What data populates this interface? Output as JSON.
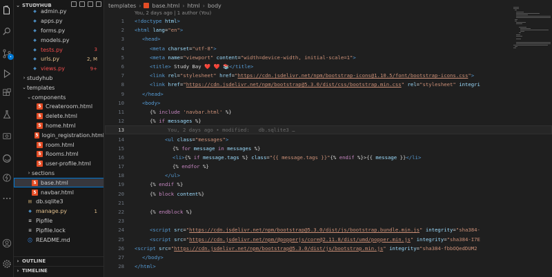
{
  "explorer": {
    "root": "STUDYHUB",
    "items": [
      {
        "name": "admin.py",
        "type": "py",
        "depth": 2
      },
      {
        "name": "apps.py",
        "type": "py",
        "depth": 2
      },
      {
        "name": "forms.py",
        "type": "py",
        "depth": 2
      },
      {
        "name": "models.py",
        "type": "py",
        "depth": 2
      },
      {
        "name": "tests.py",
        "type": "py",
        "depth": 2,
        "badge": "3",
        "status": "error"
      },
      {
        "name": "urls.py",
        "type": "py",
        "depth": 2,
        "badge": "2, M",
        "status": "modified"
      },
      {
        "name": "views.py",
        "type": "py",
        "depth": 2,
        "badge": "9+",
        "status": "error"
      },
      {
        "name": "studyhub",
        "type": "folder",
        "depth": 1,
        "expanded": false
      },
      {
        "name": "templates",
        "type": "folder",
        "depth": 1,
        "expanded": true
      },
      {
        "name": "components",
        "type": "folder",
        "depth": 2,
        "expanded": true
      },
      {
        "name": "Createroom.html",
        "type": "html",
        "depth": 3
      },
      {
        "name": "delete.html",
        "type": "html",
        "depth": 3
      },
      {
        "name": "home.html",
        "type": "html",
        "depth": 3
      },
      {
        "name": "login_registration.html",
        "type": "html",
        "depth": 3
      },
      {
        "name": "room.html",
        "type": "html",
        "depth": 3
      },
      {
        "name": "Rooms.html",
        "type": "html",
        "depth": 3
      },
      {
        "name": "user-profile.html",
        "type": "html",
        "depth": 3
      },
      {
        "name": "sections",
        "type": "folder",
        "depth": 2,
        "expanded": false
      },
      {
        "name": "base.html",
        "type": "html",
        "depth": 2,
        "selected": true
      },
      {
        "name": "navbar.html",
        "type": "html",
        "depth": 2
      },
      {
        "name": "db.sqlite3",
        "type": "db",
        "depth": 1
      },
      {
        "name": "manage.py",
        "type": "py",
        "depth": 1,
        "badge": "1",
        "status": "modified"
      },
      {
        "name": "Pipfile",
        "type": "txt",
        "depth": 1
      },
      {
        "name": "Pipfile.lock",
        "type": "txt",
        "depth": 1
      },
      {
        "name": "README.md",
        "type": "info",
        "depth": 1
      }
    ],
    "outline_label": "OUTLINE",
    "timeline_label": "TIMELINE"
  },
  "breadcrumb": [
    "templates",
    "base.html",
    "html",
    "body"
  ],
  "blame_header": "You, 2 days ago | 1 author (You)",
  "inline_blame": "You, 2 days ago • modified:   db.sqlite3 …",
  "active_line": 13,
  "code_lines": [
    {
      "n": "1",
      "indent": 0,
      "parts": [
        [
          "tag",
          "<!doctype "
        ],
        [
          "attr",
          "html"
        ],
        [
          "tag",
          ">"
        ]
      ]
    },
    {
      "n": "2",
      "indent": 0,
      "parts": [
        [
          "tag",
          "<html "
        ],
        [
          "attr",
          "lang"
        ],
        [
          "txt",
          "="
        ],
        [
          "str",
          "\"en\""
        ],
        [
          "tag",
          ">"
        ]
      ]
    },
    {
      "n": "3",
      "indent": 1,
      "parts": [
        [
          "tag",
          "<head>"
        ]
      ]
    },
    {
      "n": "4",
      "indent": 2,
      "parts": [
        [
          "tag",
          "<meta "
        ],
        [
          "attr",
          "charset"
        ],
        [
          "txt",
          "="
        ],
        [
          "str",
          "\"utf-8\""
        ],
        [
          "tag",
          ">"
        ]
      ]
    },
    {
      "n": "5",
      "indent": 2,
      "parts": [
        [
          "tag",
          "<meta "
        ],
        [
          "attr",
          "name"
        ],
        [
          "txt",
          "="
        ],
        [
          "str",
          "\"viewport\" "
        ],
        [
          "attr",
          "content"
        ],
        [
          "txt",
          "="
        ],
        [
          "str",
          "\"width=device-width, initial-scale=1\""
        ],
        [
          "tag",
          ">"
        ]
      ]
    },
    {
      "n": "6",
      "indent": 2,
      "parts": [
        [
          "tag",
          "<title>"
        ],
        [
          "txt",
          " Study Bay "
        ],
        [
          "heart",
          "❤️ ❤️ "
        ],
        [
          "txt",
          "📚"
        ],
        [
          "tag",
          "</title>"
        ]
      ]
    },
    {
      "n": "7",
      "indent": 2,
      "parts": [
        [
          "tag",
          "<link "
        ],
        [
          "attr",
          "rel"
        ],
        [
          "txt",
          "="
        ],
        [
          "str",
          "\"stylesheet\" "
        ],
        [
          "attr",
          "href"
        ],
        [
          "txt",
          "="
        ],
        [
          "str",
          "\""
        ],
        [
          "lnk",
          "https://cdn.jsdelivr.net/npm/bootstrap-icons@1.10.5/font/bootstrap-icons.css"
        ],
        [
          "str",
          "\""
        ],
        [
          "tag",
          ">"
        ]
      ]
    },
    {
      "n": "8",
      "indent": 2,
      "parts": [
        [
          "tag",
          "<link "
        ],
        [
          "attr",
          "href"
        ],
        [
          "txt",
          "="
        ],
        [
          "str",
          "\""
        ],
        [
          "lnk",
          "https://cdn.jsdelivr.net/npm/bootstrap@5.3.0/dist/css/bootstrap.min.css"
        ],
        [
          "str",
          "\" "
        ],
        [
          "attr",
          "rel"
        ],
        [
          "txt",
          "="
        ],
        [
          "str",
          "\"stylesheet\" "
        ],
        [
          "attr",
          "integri"
        ]
      ]
    },
    {
      "n": "9",
      "indent": 1,
      "parts": [
        [
          "tag",
          "</head>"
        ]
      ]
    },
    {
      "n": "10",
      "indent": 1,
      "parts": [
        [
          "tag",
          "<body>"
        ]
      ]
    },
    {
      "n": "11",
      "indent": 2,
      "parts": [
        [
          "txt",
          "{% "
        ],
        [
          "kw",
          "include "
        ],
        [
          "str",
          "'navbar.html'"
        ],
        [
          "txt",
          " %}"
        ]
      ]
    },
    {
      "n": "12",
      "indent": 2,
      "parts": [
        [
          "txt",
          "{% "
        ],
        [
          "kw",
          "if "
        ],
        [
          "attr",
          "messages"
        ],
        [
          "txt",
          " %}"
        ]
      ]
    },
    {
      "n": "13",
      "indent": 0,
      "parts": []
    },
    {
      "n": "14",
      "indent": 4,
      "parts": [
        [
          "tag",
          "<ul "
        ],
        [
          "attr",
          "class"
        ],
        [
          "txt",
          "="
        ],
        [
          "str",
          "\"messages\""
        ],
        [
          "tag",
          ">"
        ]
      ]
    },
    {
      "n": "15",
      "indent": 5,
      "parts": [
        [
          "txt",
          "{% "
        ],
        [
          "kw",
          "for "
        ],
        [
          "attr",
          "message "
        ],
        [
          "kw",
          "in "
        ],
        [
          "attr",
          "messages"
        ],
        [
          "txt",
          " %}"
        ]
      ]
    },
    {
      "n": "16",
      "indent": 5,
      "parts": [
        [
          "tag",
          "<li>"
        ],
        [
          "txt",
          "{% "
        ],
        [
          "kw",
          "if "
        ],
        [
          "attr",
          "message.tags"
        ],
        [
          "txt",
          " %} "
        ],
        [
          "attr",
          "class"
        ],
        [
          "txt",
          "="
        ],
        [
          "str",
          "\"{{ message.tags }}\""
        ],
        [
          "txt",
          "{% "
        ],
        [
          "kw",
          "endif"
        ],
        [
          "txt",
          " %}>{{ "
        ],
        [
          "attr",
          "message"
        ],
        [
          "txt",
          " }}"
        ],
        [
          "tag",
          "</li>"
        ]
      ]
    },
    {
      "n": "17",
      "indent": 5,
      "parts": [
        [
          "txt",
          "{% "
        ],
        [
          "kw",
          "endfor"
        ],
        [
          "txt",
          " %}"
        ]
      ]
    },
    {
      "n": "18",
      "indent": 4,
      "parts": [
        [
          "tag",
          "</ul>"
        ]
      ]
    },
    {
      "n": "19",
      "indent": 2,
      "parts": [
        [
          "txt",
          "{% "
        ],
        [
          "kw",
          "endif"
        ],
        [
          "txt",
          " %}"
        ]
      ]
    },
    {
      "n": "20",
      "indent": 2,
      "parts": [
        [
          "txt",
          "{% "
        ],
        [
          "kw",
          "block "
        ],
        [
          "attr",
          "content"
        ],
        [
          "txt",
          "%}"
        ]
      ]
    },
    {
      "n": "21",
      "indent": 0,
      "parts": []
    },
    {
      "n": "22",
      "indent": 2,
      "parts": [
        [
          "txt",
          "{% "
        ],
        [
          "kw",
          "endblock"
        ],
        [
          "txt",
          " %}"
        ]
      ]
    },
    {
      "n": "23",
      "indent": 0,
      "parts": []
    },
    {
      "n": "24",
      "indent": 2,
      "parts": [
        [
          "tag",
          "<script "
        ],
        [
          "attr",
          "src"
        ],
        [
          "txt",
          "="
        ],
        [
          "str",
          "\""
        ],
        [
          "lnk",
          "https://cdn.jsdelivr.net/npm/bootstrap@5.3.0/dist/js/bootstrap.bundle.min.js"
        ],
        [
          "str",
          "\" "
        ],
        [
          "attr",
          "integrity"
        ],
        [
          "txt",
          "="
        ],
        [
          "str",
          "\"sha384-"
        ]
      ]
    },
    {
      "n": "25",
      "indent": 2,
      "parts": [
        [
          "tag",
          "<script "
        ],
        [
          "attr",
          "src"
        ],
        [
          "txt",
          "="
        ],
        [
          "str",
          "\""
        ],
        [
          "lnk",
          "https://cdn.jsdelivr.net/npm/@popperjs/core@2.11.8/dist/umd/popper.min.js"
        ],
        [
          "str",
          "\" "
        ],
        [
          "attr",
          "integrity"
        ],
        [
          "txt",
          "="
        ],
        [
          "str",
          "\"sha384-I7E"
        ]
      ]
    },
    {
      "n": "26",
      "indent": 0,
      "parts": [
        [
          "tag",
          "<script "
        ],
        [
          "attr",
          "src"
        ],
        [
          "txt",
          "="
        ],
        [
          "str",
          "\""
        ],
        [
          "lnk",
          "https://cdn.jsdelivr.net/npm/bootstrap@5.3.0/dist/js/bootstrap.min.js"
        ],
        [
          "str",
          "\" "
        ],
        [
          "attr",
          "integrity"
        ],
        [
          "txt",
          "="
        ],
        [
          "str",
          "\"sha384-fbbOQedDUM2"
        ]
      ]
    },
    {
      "n": "27",
      "indent": 1,
      "parts": [
        [
          "tag",
          "</body>"
        ]
      ]
    },
    {
      "n": "28",
      "indent": 0,
      "parts": [
        [
          "tag",
          "</html>"
        ]
      ]
    }
  ],
  "colors": {
    "tag": "#569cd6",
    "attr": "#9cdcfe",
    "string": "#ce9178",
    "keyword": "#c586c0",
    "accent": "#0078d4",
    "error": "#f14c4c",
    "modified": "#e2c08d"
  },
  "activity_icons": [
    "files-icon",
    "search-icon",
    "source-control-icon",
    "run-debug-icon",
    "extensions-icon",
    "testing-icon",
    "remote-explorer-icon",
    "edge-devtools-icon",
    "thunder-client-icon",
    "more-icon",
    "account-icon",
    "settings-gear-icon"
  ]
}
